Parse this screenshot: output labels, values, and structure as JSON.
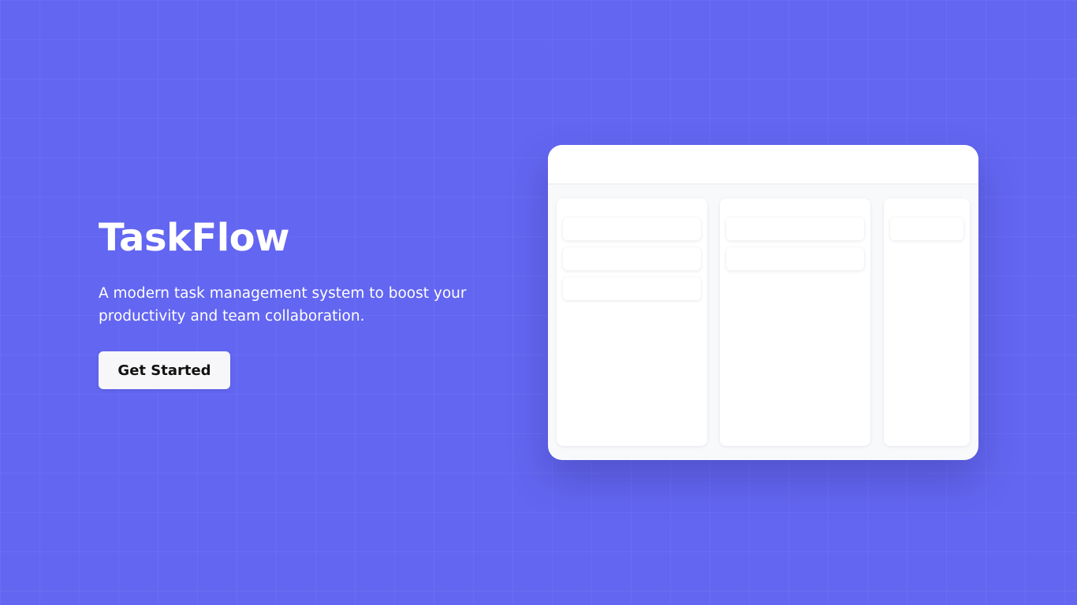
{
  "hero": {
    "title": "TaskFlow",
    "subtitle": "A modern task management system to boost your productivity and team collaboration.",
    "cta_label": "Get Started"
  },
  "mockup": {
    "columns": [
      {
        "cards": 3
      },
      {
        "cards": 2
      },
      {
        "cards": 1
      }
    ]
  },
  "colors": {
    "background": "#6366f1",
    "text": "#ffffff",
    "button_bg": "#f7f7f9",
    "button_text": "#111111"
  }
}
